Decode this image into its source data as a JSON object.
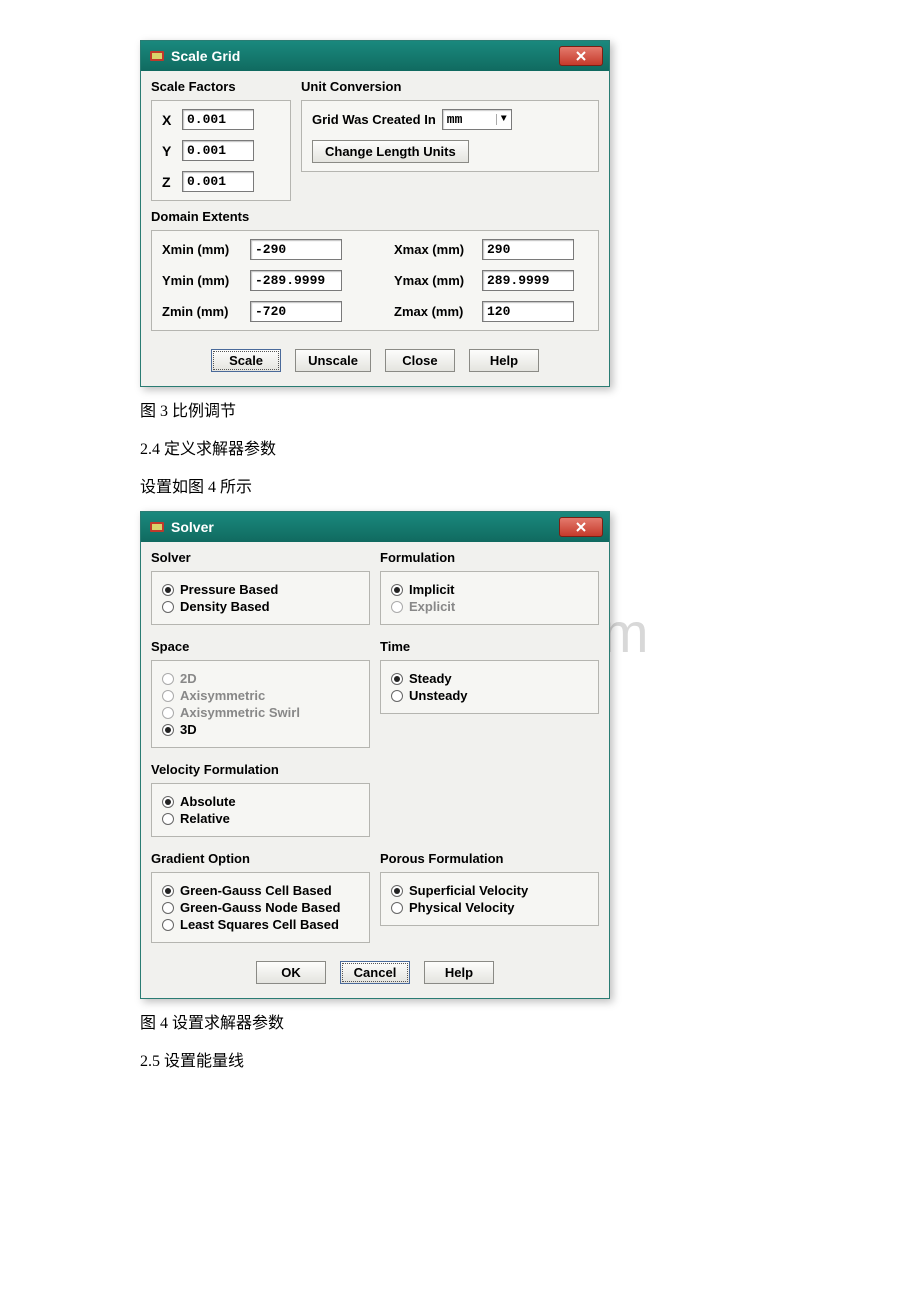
{
  "dialog1": {
    "title": "Scale Grid",
    "sections": {
      "scale_factors": "Scale Factors",
      "unit_conversion": "Unit Conversion",
      "domain_extents": "Domain Extents"
    },
    "scale": {
      "x_label": "X",
      "y_label": "Y",
      "z_label": "Z",
      "x_value": "0.001",
      "y_value": "0.001",
      "z_value": "0.001"
    },
    "unit_conv": {
      "created_in_label": "Grid Was Created In",
      "created_in_value": "mm",
      "change_units_btn": "Change Length Units"
    },
    "domain": {
      "xmin_label": "Xmin (mm)",
      "xmax_label": "Xmax (mm)",
      "ymin_label": "Ymin (mm)",
      "ymax_label": "Ymax (mm)",
      "zmin_label": "Zmin (mm)",
      "zmax_label": "Zmax (mm)",
      "xmin": "-290",
      "xmax": "290",
      "ymin": "-289.9999",
      "ymax": "289.9999",
      "zmin": "-720",
      "zmax": "120"
    },
    "buttons": {
      "scale": "Scale",
      "unscale": "Unscale",
      "close": "Close",
      "help": "Help"
    }
  },
  "caption1": "图 3 比例调节",
  "section24": "2.4 定义求解器参数",
  "desc24": "设置如图 4 所示",
  "watermark": "www.bdocx.com",
  "dialog2": {
    "title": "Solver",
    "groups": {
      "solver": "Solver",
      "formulation": "Formulation",
      "space": "Space",
      "time": "Time",
      "velocity": "Velocity Formulation",
      "gradient": "Gradient Option",
      "porous": "Porous Formulation"
    },
    "solver_opts": {
      "pressure": "Pressure Based",
      "density": "Density Based"
    },
    "formulation_opts": {
      "implicit": "Implicit",
      "explicit": "Explicit"
    },
    "space_opts": {
      "d2": "2D",
      "axi": "Axisymmetric",
      "axi_swirl": "Axisymmetric Swirl",
      "d3": "3D"
    },
    "time_opts": {
      "steady": "Steady",
      "unsteady": "Unsteady"
    },
    "velocity_opts": {
      "absolute": "Absolute",
      "relative": "Relative"
    },
    "gradient_opts": {
      "gg_cell": "Green-Gauss Cell Based",
      "gg_node": "Green-Gauss Node Based",
      "lsq": "Least Squares Cell Based"
    },
    "porous_opts": {
      "superficial": "Superficial Velocity",
      "physical": "Physical Velocity"
    },
    "buttons": {
      "ok": "OK",
      "cancel": "Cancel",
      "help": "Help"
    }
  },
  "caption2": "图 4 设置求解器参数",
  "section25": "2.5 设置能量线"
}
